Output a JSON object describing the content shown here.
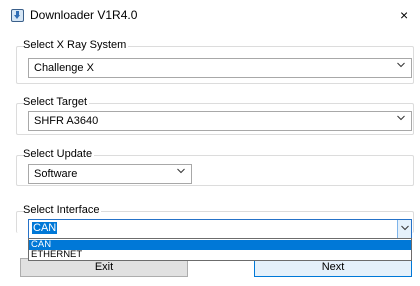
{
  "window": {
    "title": "Downloader V1R4.0",
    "close_glyph": "×"
  },
  "groups": [
    {
      "label": "Select X Ray System",
      "value": "Challenge X"
    },
    {
      "label": "Select Target",
      "value": "SHFR A3640"
    },
    {
      "label": "Select Update",
      "value": "Software"
    },
    {
      "label": "Select Interface",
      "value": "CAN"
    }
  ],
  "interface_dropdown": {
    "options": [
      "CAN",
      "ETHERNET"
    ],
    "selected": "CAN"
  },
  "buttons": {
    "exit": "Exit",
    "next": "Next"
  },
  "icons": {
    "app": "download-app-icon",
    "chevron": "chevron-down-icon"
  },
  "colors": {
    "selection": "#0078d7",
    "focus_border": "#2672c8"
  }
}
